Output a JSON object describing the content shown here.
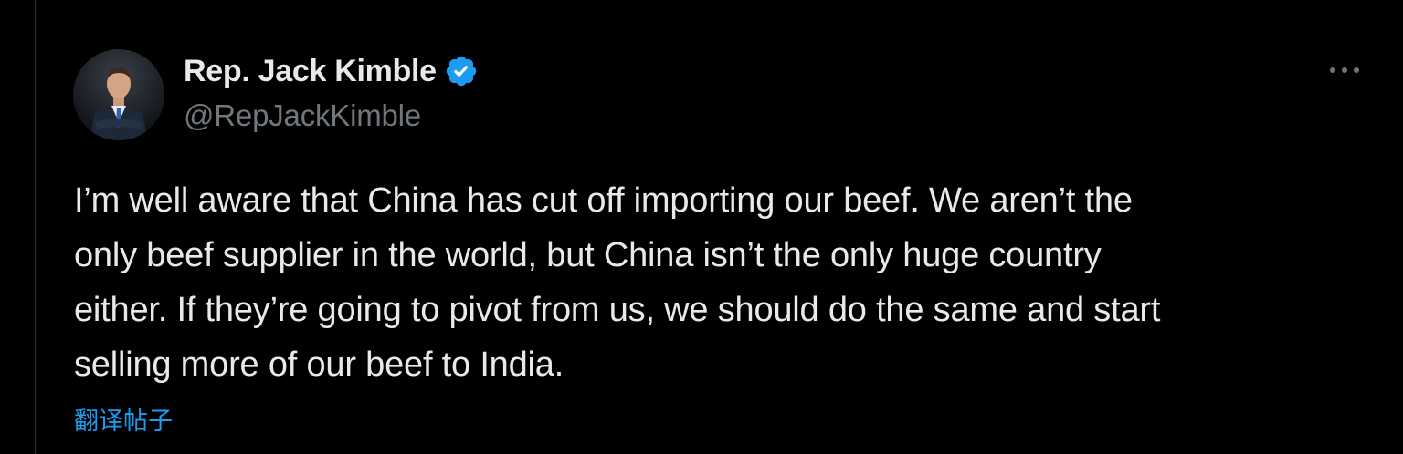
{
  "tweet": {
    "author": {
      "name": "Rep. Jack Kimble",
      "handle": "@RepJackKimble",
      "verified": true,
      "avatar_icon": "profile-photo"
    },
    "text": "I’m well aware that China has cut off importing our beef. We aren’t the\nonly beef supplier in the world, but China isn’t the only huge country\neither. If they’re going to pivot from us, we should do the same and start\nselling more of our beef to India.",
    "translate_label": "翻译帖子",
    "more_icon": "more-horizontal-icon"
  },
  "colors": {
    "background": "#000000",
    "primary_text": "#e7e9ea",
    "secondary_text": "#71767b",
    "accent": "#1d9bf0",
    "border": "#2f3336"
  }
}
